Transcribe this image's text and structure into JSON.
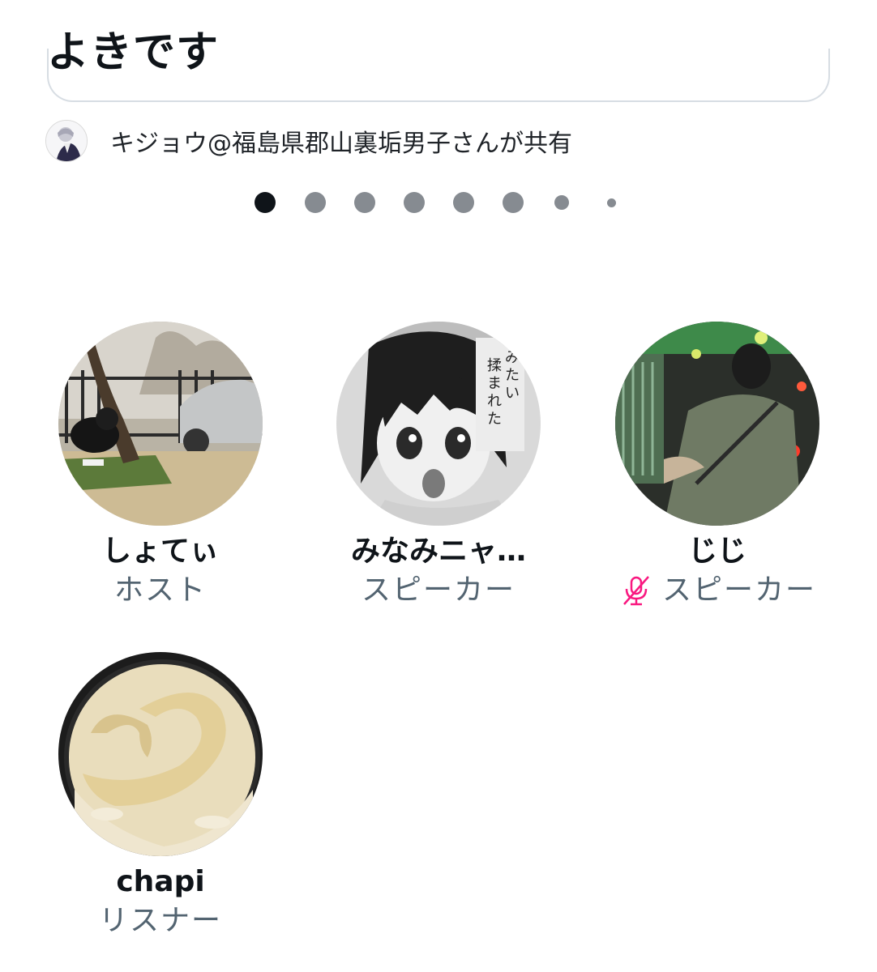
{
  "space": {
    "title": "よきです",
    "shared_by_text": "キジョウ@福島県郡山裏垢男子さんが共有"
  },
  "pagination": {
    "total_dots": 8,
    "active_index": 0
  },
  "participants": [
    {
      "name": "しょてぃ",
      "role": "ホスト",
      "muted": false,
      "avatar_icon": "park-photo-avatar"
    },
    {
      "name": "みなみニャ…",
      "role": "スピーカー",
      "muted": false,
      "avatar_icon": "manga-girl-avatar"
    },
    {
      "name": "じじ",
      "role": "スピーカー",
      "muted": true,
      "avatar_icon": "night-street-avatar"
    },
    {
      "name": "chapi",
      "role": "リスナー",
      "muted": false,
      "avatar_icon": "ice-cream-avatar"
    }
  ],
  "colors": {
    "text": "#0f1419",
    "secondary_text": "#536471",
    "dot_inactive": "#868b91",
    "mute_pink": "#f91880"
  }
}
